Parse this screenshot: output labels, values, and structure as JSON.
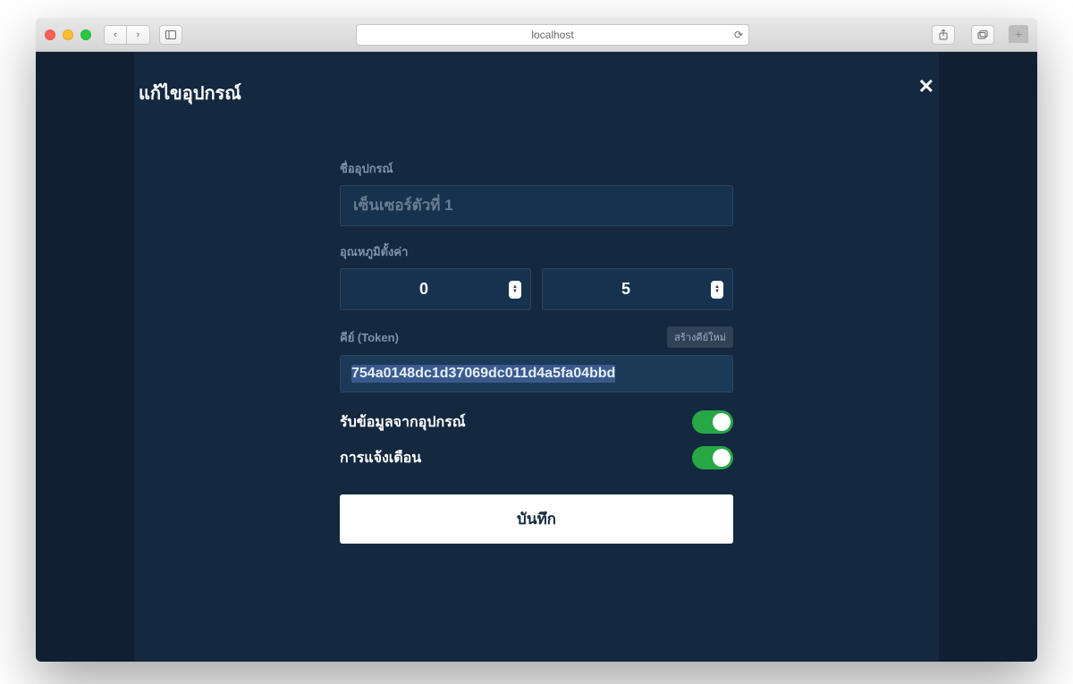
{
  "browser": {
    "address": "localhost"
  },
  "modal": {
    "title": "แก้ไขอุปกรณ์"
  },
  "form": {
    "device_name_label": "ชื่ออุปกรณ์",
    "device_name_placeholder": "เซ็นเซอร์ตัวที่ 1",
    "device_name_value": "",
    "threshold_label": "อุณหภูมิตั้งค่า",
    "threshold_min": "0",
    "threshold_max": "5",
    "token_label": "คีย์ (Token)",
    "token_regen_label": "สร้างคีย์ใหม่",
    "token_value": "754a0148dc1d37069dc011d4a5fa04bbd",
    "switch_receive_label": "รับข้อมูลจากอุปกรณ์",
    "switch_receive_on": true,
    "switch_alert_label": "การแจ้งเตือน",
    "switch_alert_on": true,
    "save_label": "บันทึก"
  }
}
